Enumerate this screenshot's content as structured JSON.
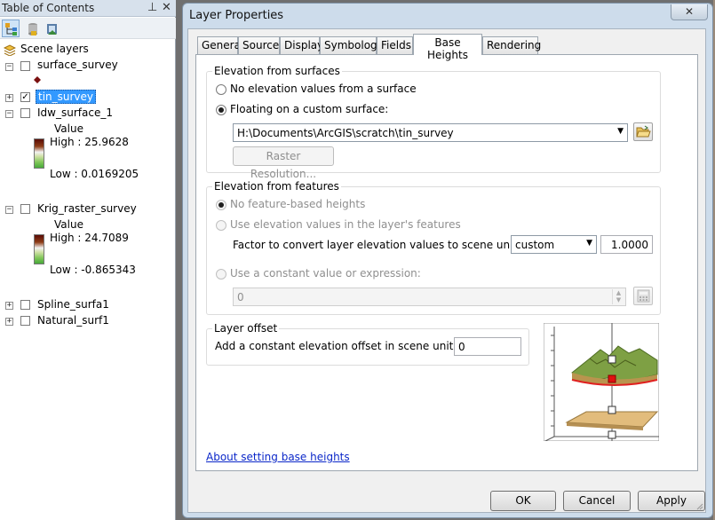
{
  "toc": {
    "title": "Table of Contents",
    "root_label": "Scene layers",
    "layers": [
      {
        "name": "surface_survey",
        "checked": false,
        "expand": "−"
      },
      {
        "name": "tin_survey",
        "checked": true,
        "expand": "+"
      },
      {
        "name": "Idw_surface_1",
        "checked": false,
        "expand": "−",
        "legend_title": "Value",
        "high": "High : 25.9628",
        "low": "Low : 0.0169205"
      },
      {
        "name": "Krig_raster_survey",
        "checked": false,
        "expand": "−",
        "legend_title": "Value",
        "high": "High : 24.7089",
        "low": "Low : -0.865343"
      },
      {
        "name": "Spline_surfa1",
        "checked": false,
        "expand": "+"
      },
      {
        "name": "Natural_surf1",
        "checked": false,
        "expand": "+"
      }
    ]
  },
  "dialog": {
    "title": "Layer Properties",
    "close": "✕",
    "tabs": [
      "General",
      "Source",
      "Display",
      "Symbology",
      "Fields",
      "Base Heights",
      "Rendering"
    ],
    "active_tab": "Base Heights",
    "surfaces": {
      "title": "Elevation from surfaces",
      "opt_none": "No elevation values from a surface",
      "opt_float": "Floating on a custom surface:",
      "surface_path": "H:\\Documents\\ArcGIS\\scratch\\tin_survey",
      "raster_btn": "Raster Resolution..."
    },
    "features": {
      "title": "Elevation from features",
      "opt_none": "No feature-based heights",
      "opt_layer": "Use elevation values in the layer's features",
      "factor_label": "Factor to convert layer elevation values to scene units:",
      "unit_select": "custom",
      "factor_value": "1.0000",
      "opt_const": "Use a constant value or expression:",
      "const_value": "0"
    },
    "offset": {
      "title": "Layer offset",
      "label": "Add a constant elevation offset in scene units:",
      "value": "0"
    },
    "help_link": "About setting base heights",
    "buttons": {
      "ok": "OK",
      "cancel": "Cancel",
      "apply": "Apply"
    }
  }
}
